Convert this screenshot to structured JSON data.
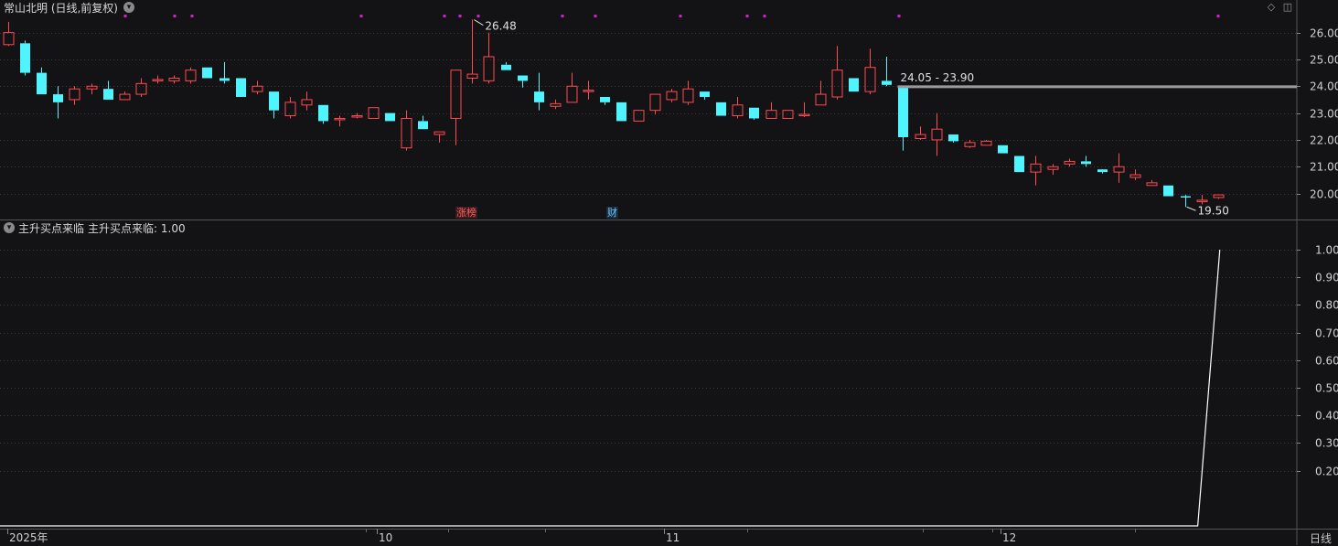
{
  "header": {
    "title": "常山北明 (日线,前复权)",
    "indicator_title": "主升买点来临",
    "indicator_value_label": "主升买点来临: 1.00",
    "period_label": "日线"
  },
  "markers": {
    "zhangbang": "涨榜",
    "cai": "财",
    "high_label": "26.48",
    "low_label": "19.50",
    "range_label": "24.05 - 23.90"
  },
  "icons": {
    "diamond": "diamond-icon",
    "panel": "panel-icon",
    "collapse": "chevron-down-icon"
  },
  "colors": {
    "up": "#ff4a52",
    "down": "#4ef5ff",
    "background": "#131214",
    "grid": "#3a3a3a",
    "range_line": "#9a9a9a",
    "marker": "#d020d0"
  },
  "chart_data": [
    {
      "type": "candlestick",
      "title": "常山北明 (日线,前复权)",
      "ylim": [
        19.1,
        26.6
      ],
      "y_ticks": [
        "26.00",
        "25.00",
        "24.00",
        "23.00",
        "22.00",
        "21.00",
        "20.00"
      ],
      "x_labels": [
        "2025年",
        "10",
        "11",
        "12"
      ],
      "grid": true,
      "annotations": [
        "26.48",
        "19.50",
        "24.05 - 23.90",
        "涨榜",
        "财"
      ],
      "series": [
        {
          "ohlc": [
            [
              25.55,
              26.4,
              25.5,
              26.0
            ],
            [
              25.6,
              25.7,
              24.4,
              24.5
            ],
            [
              24.5,
              24.7,
              23.7,
              23.7
            ],
            [
              23.7,
              24.0,
              22.8,
              23.4
            ],
            [
              23.5,
              24.0,
              23.3,
              23.9
            ],
            [
              23.9,
              24.1,
              23.7,
              24.0
            ],
            [
              23.9,
              24.2,
              23.5,
              23.5
            ],
            [
              23.5,
              23.8,
              23.5,
              23.7
            ],
            [
              23.7,
              24.3,
              23.6,
              24.1
            ],
            [
              24.2,
              24.4,
              24.1,
              24.25
            ],
            [
              24.2,
              24.4,
              24.1,
              24.3
            ],
            [
              24.2,
              24.7,
              24.1,
              24.6
            ],
            [
              24.7,
              24.7,
              24.3,
              24.3
            ],
            [
              24.3,
              24.9,
              24.1,
              24.2
            ],
            [
              24.3,
              24.3,
              23.6,
              23.6
            ],
            [
              23.8,
              24.2,
              23.7,
              24.0
            ],
            [
              23.8,
              23.8,
              22.8,
              23.1
            ],
            [
              22.9,
              23.6,
              22.8,
              23.4
            ],
            [
              23.3,
              23.8,
              23.1,
              23.5
            ],
            [
              23.3,
              23.3,
              22.6,
              22.7
            ],
            [
              22.75,
              22.9,
              22.5,
              22.8
            ],
            [
              22.85,
              23.0,
              22.8,
              22.9
            ],
            [
              22.8,
              23.2,
              22.8,
              23.2
            ],
            [
              23.0,
              23.0,
              22.7,
              22.7
            ],
            [
              21.7,
              23.1,
              21.6,
              22.8
            ],
            [
              22.7,
              22.9,
              22.4,
              22.4
            ],
            [
              22.2,
              22.3,
              21.9,
              22.3
            ],
            [
              22.8,
              24.6,
              21.8,
              24.6
            ],
            [
              24.3,
              26.48,
              24.1,
              24.45
            ],
            [
              24.2,
              26.0,
              24.1,
              25.1
            ],
            [
              24.8,
              24.9,
              24.6,
              24.6
            ],
            [
              24.4,
              24.4,
              23.95,
              24.2
            ],
            [
              23.8,
              24.5,
              23.1,
              23.4
            ],
            [
              23.25,
              23.5,
              23.15,
              23.35
            ],
            [
              23.4,
              24.5,
              23.4,
              24.0
            ],
            [
              23.8,
              24.2,
              23.5,
              23.85
            ],
            [
              23.6,
              23.6,
              23.3,
              23.4
            ],
            [
              23.4,
              23.4,
              22.7,
              22.7
            ],
            [
              22.7,
              23.1,
              22.7,
              23.1
            ],
            [
              23.1,
              23.7,
              22.95,
              23.7
            ],
            [
              23.5,
              23.9,
              23.4,
              23.8
            ],
            [
              23.4,
              24.2,
              23.3,
              23.9
            ],
            [
              23.8,
              23.8,
              23.5,
              23.6
            ],
            [
              23.4,
              23.4,
              22.9,
              22.9
            ],
            [
              22.9,
              23.6,
              22.8,
              23.3
            ],
            [
              23.2,
              23.2,
              22.75,
              22.8
            ],
            [
              22.8,
              23.4,
              22.8,
              23.1
            ],
            [
              22.8,
              23.1,
              22.8,
              23.1
            ],
            [
              22.9,
              23.4,
              22.85,
              22.95
            ],
            [
              23.3,
              24.2,
              23.3,
              23.7
            ],
            [
              23.6,
              25.5,
              23.5,
              24.6
            ],
            [
              24.3,
              24.3,
              23.8,
              23.8
            ],
            [
              23.8,
              25.4,
              23.7,
              24.7
            ],
            [
              24.2,
              25.1,
              24.0,
              24.05
            ],
            [
              23.95,
              24.0,
              21.6,
              22.1
            ],
            [
              22.05,
              22.5,
              22.0,
              22.2
            ],
            [
              22.0,
              23.0,
              21.4,
              22.4
            ],
            [
              22.2,
              22.2,
              21.9,
              21.95
            ],
            [
              21.75,
              22.0,
              21.7,
              21.9
            ],
            [
              21.8,
              22.0,
              21.8,
              21.95
            ],
            [
              21.8,
              21.8,
              21.5,
              21.5
            ],
            [
              21.4,
              21.4,
              20.8,
              20.8
            ],
            [
              20.8,
              21.4,
              20.3,
              21.1
            ],
            [
              20.9,
              21.1,
              20.7,
              21.0
            ],
            [
              21.1,
              21.3,
              21.0,
              21.2
            ],
            [
              21.2,
              21.4,
              21.0,
              21.1
            ],
            [
              20.9,
              20.9,
              20.75,
              20.8
            ],
            [
              20.8,
              21.5,
              20.4,
              21.0
            ],
            [
              20.6,
              20.9,
              20.5,
              20.7
            ],
            [
              20.3,
              20.5,
              20.3,
              20.4
            ],
            [
              20.3,
              20.3,
              19.9,
              19.9
            ],
            [
              19.9,
              19.95,
              19.5,
              19.85
            ],
            [
              19.7,
              19.95,
              19.6,
              19.75
            ],
            [
              19.85,
              19.95,
              19.8,
              19.95
            ]
          ]
        }
      ]
    },
    {
      "type": "line",
      "title": "主升买点来临",
      "ylim": [
        0,
        1.05
      ],
      "y_ticks": [
        "1.00",
        "0.90",
        "0.80",
        "0.70",
        "0.60",
        "0.50",
        "0.40",
        "0.30",
        "0.20"
      ],
      "series": [
        {
          "name": "主升买点来临",
          "values": [
            0,
            0,
            0,
            0,
            0,
            0,
            0,
            0,
            0,
            0,
            0,
            0,
            0,
            0,
            0,
            0,
            0,
            0,
            0,
            0,
            0,
            0,
            0,
            0,
            0,
            0,
            0,
            0,
            0,
            0,
            0,
            0,
            0,
            0,
            0,
            0,
            0,
            0,
            0,
            0,
            0,
            0,
            0,
            0,
            0,
            0,
            0,
            0,
            0,
            0,
            0,
            0,
            0,
            0,
            0,
            0,
            0,
            0,
            0,
            0,
            0,
            0,
            0,
            0,
            0,
            0,
            0,
            0,
            0,
            0,
            0,
            0,
            0,
            1
          ]
        }
      ]
    }
  ]
}
